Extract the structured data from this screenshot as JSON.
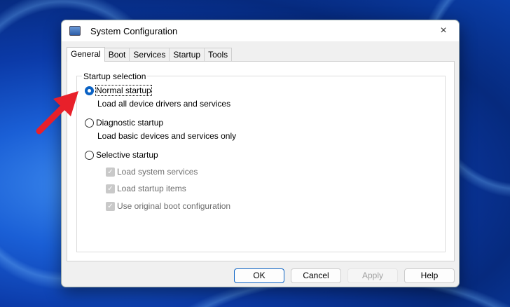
{
  "window": {
    "title": "System Configuration",
    "close_icon": "×"
  },
  "tabs": [
    {
      "label": "General",
      "active": true
    },
    {
      "label": "Boot"
    },
    {
      "label": "Services"
    },
    {
      "label": "Startup"
    },
    {
      "label": "Tools"
    }
  ],
  "general": {
    "group_label": "Startup selection",
    "normal": {
      "label": "Normal startup",
      "desc": "Load all device drivers and services",
      "selected": true
    },
    "diagnostic": {
      "label": "Diagnostic startup",
      "desc": "Load basic devices and services only"
    },
    "selective": {
      "label": "Selective startup",
      "options": [
        "Load system services",
        "Load startup items",
        "Use original boot configuration"
      ]
    }
  },
  "buttons": {
    "ok": "OK",
    "cancel": "Cancel",
    "apply": "Apply",
    "help": "Help"
  },
  "colors": {
    "accent": "#0a62c4",
    "arrow": "#e8202a"
  }
}
